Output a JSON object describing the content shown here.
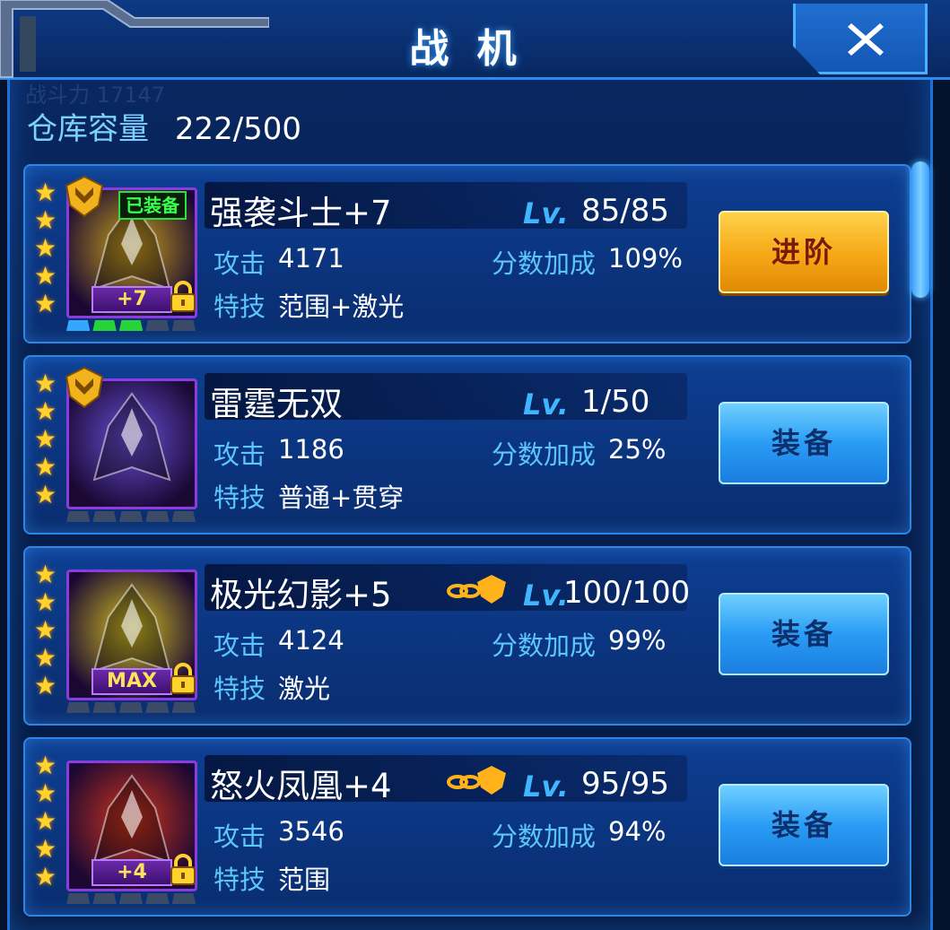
{
  "window": {
    "title": "战 机",
    "close_label": "✕",
    "ghost_text": "战斗力 17147"
  },
  "capacity": {
    "label": "仓库容量",
    "value": "222/500"
  },
  "labels": {
    "lv": "Lv.",
    "attack": "攻击",
    "skill": "特技",
    "score_bonus": "分数加成"
  },
  "fighters": [
    {
      "name": "强袭斗士+7",
      "level": "85/85",
      "attack": "4171",
      "score_bonus": "109%",
      "skill": "范围+激光",
      "button": "进阶",
      "button_style": "gold",
      "equipped_tag": "已装备",
      "badge": "+7",
      "stars": 5,
      "locked": true,
      "chain": false,
      "portrait_color": "#c9a21a",
      "slots": [
        "blue",
        "green",
        "green",
        "empty",
        "empty"
      ]
    },
    {
      "name": "雷霆无双",
      "level": "1/50",
      "attack": "1186",
      "score_bonus": "25%",
      "skill": "普通+贯穿",
      "button": "装备",
      "button_style": "blue",
      "equipped_tag": "",
      "badge": "",
      "stars": 5,
      "locked": false,
      "chain": false,
      "portrait_color": "#6a4fd6",
      "slots": [
        "empty",
        "empty",
        "empty",
        "empty",
        "empty"
      ]
    },
    {
      "name": "极光幻影+5",
      "level": "100/100",
      "attack": "4124",
      "score_bonus": "99%",
      "skill": "激光",
      "button": "装备",
      "button_style": "blue",
      "equipped_tag": "",
      "badge": "MAX",
      "stars": 5,
      "locked": true,
      "chain": true,
      "portrait_color": "#d4c020",
      "slots": [
        "empty",
        "empty",
        "empty",
        "empty",
        "empty"
      ]
    },
    {
      "name": "怒火凤凰+4",
      "level": "95/95",
      "attack": "3546",
      "score_bonus": "94%",
      "skill": "范围",
      "button": "装备",
      "button_style": "blue",
      "equipped_tag": "",
      "badge": "+4",
      "stars": 5,
      "locked": true,
      "chain": true,
      "portrait_color": "#d0341c",
      "slots": [
        "empty",
        "empty",
        "empty",
        "empty",
        "empty"
      ]
    }
  ],
  "colors": {
    "accent": "#3fb6ff",
    "star": "#ffd22e",
    "frame": "#2d86e6"
  }
}
